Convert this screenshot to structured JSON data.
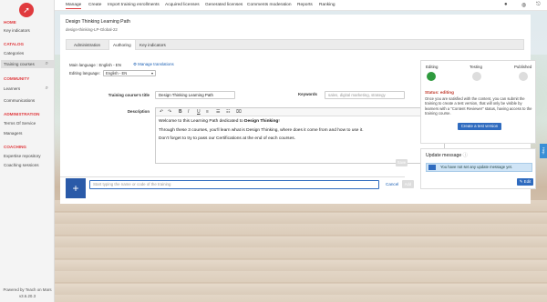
{
  "sidebar": {
    "sections": [
      {
        "title": "HOME",
        "items": [
          "Key indicators"
        ]
      },
      {
        "title": "CATALOG",
        "items": [
          "Categories",
          "Training courses"
        ]
      },
      {
        "title": "COMMUNITY",
        "items": [
          "Learners",
          "Communications"
        ]
      },
      {
        "title": "ADMINISTRATION",
        "items": [
          "Terms Of Service",
          "Managers"
        ]
      },
      {
        "title": "COACHING",
        "items": [
          "Expertise repository",
          "Coaching sessions"
        ]
      }
    ],
    "powered_by": "Powered by Teach on Mars",
    "version": "v3.6.20.3"
  },
  "topmenu": {
    "items": [
      "Manage",
      "Create",
      "Import training enrollments",
      "Acquired licenses",
      "Generated licenses",
      "Comments moderation",
      "Reports",
      "Ranking"
    ]
  },
  "page": {
    "title": "Design Thinking Learning Path",
    "subtitle": "design-thinking-LP-Global-22",
    "tabs": [
      "Administration",
      "Authoring",
      "Key indicators"
    ]
  },
  "lang": {
    "main_label": "Main language : English - EN",
    "manage_link": "Manage translations",
    "editing_label": "Editing language:",
    "editing_value": "English - EN"
  },
  "form": {
    "title_label": "Training course's title",
    "title_value": "Design Thinking Learning Path",
    "keywords_label": "Keywords",
    "keywords_placeholder": "sales, digital marketing, strategy",
    "description_label": "Description",
    "desc_p1_prefix": "Welcome to this Learning Path dedicated to ",
    "desc_p1_bold": "Design Thinking",
    "desc_p1_suffix": "!",
    "desc_p2": "Through these 3 courses, you'll learn what is Design Thinking, where does it come from and how to use it.",
    "desc_p3": "Don't forget to try to pass our Certifications at the end of each courses.",
    "save_label": "Save",
    "add_placeholder": "Start typing the name or code of the training",
    "cancel_label": "Cancel",
    "add_label": "Add"
  },
  "workflow": {
    "steps": [
      "Editing",
      "Testing",
      "Published"
    ],
    "status": "Status: editing",
    "description": "Once you are satisfied with the content, you can submit the training to create a test version, that will only be visible by learners with a \"Content Reviewer\" status, having access to the training course.",
    "create_test": "Create a test version"
  },
  "update": {
    "title": "Update message",
    "info": "You have not set any update message yet.",
    "edit": "Edit"
  },
  "help_label": "Help"
}
